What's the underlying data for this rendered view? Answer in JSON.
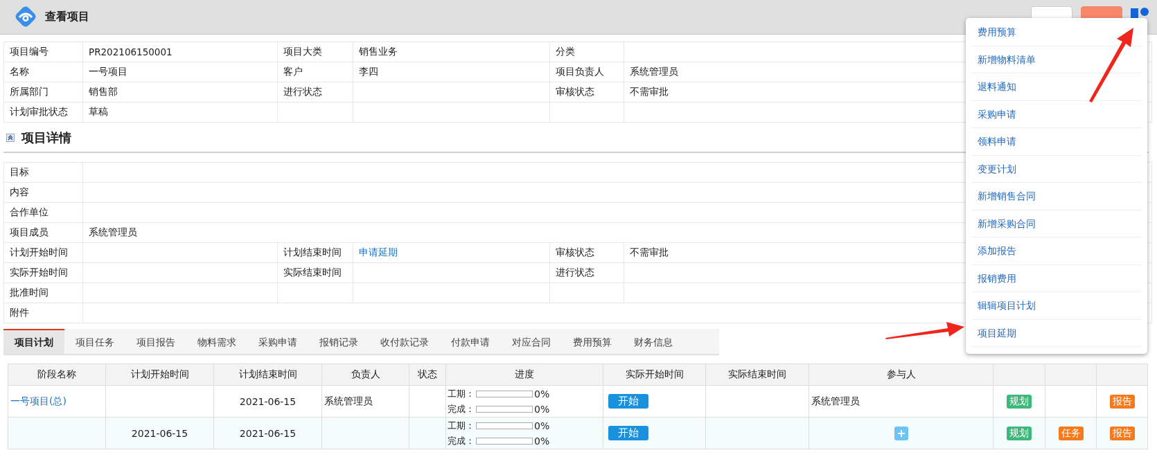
{
  "header": {
    "title": "查看项目",
    "buttons": [
      {
        "kind": "plain"
      },
      {
        "kind": "danger"
      }
    ]
  },
  "info_table": {
    "rows": [
      {
        "cells": [
          {
            "label": "项目编号",
            "value": "PR202106150001"
          },
          {
            "label": "项目大类",
            "value": "销售业务"
          },
          {
            "label": "分类"
          }
        ]
      },
      {
        "cells": [
          {
            "label": "名称",
            "value": "一号项目"
          },
          {
            "label": "客户",
            "value": "李四"
          },
          {
            "label": "项目负责人",
            "value": "系统管理员"
          }
        ]
      },
      {
        "cells": [
          {
            "label": "所属部门",
            "value": "销售部"
          },
          {
            "label": "进行状态"
          },
          {
            "label": "审核状态",
            "value": "不需审批"
          }
        ]
      },
      {
        "cells": [
          {
            "label": "计划审批状态",
            "value": "草稿"
          },
          {},
          {}
        ]
      }
    ]
  },
  "details": {
    "title": "项目详情",
    "expanded": true,
    "rows": [
      {
        "cells": [
          {
            "label": "目标"
          }
        ]
      },
      {
        "cells": [
          {
            "label": "内容"
          }
        ]
      },
      {
        "cells": [
          {
            "label": "合作单位"
          }
        ]
      },
      {
        "cells": [
          {
            "label": "项目成员",
            "value": "系统管理员"
          }
        ]
      },
      {
        "cells": [
          {
            "label": "计划开始时间"
          },
          {
            "label": "计划结束时间",
            "link": "申请延期"
          },
          {
            "label": "审核状态",
            "value": "不需审批"
          }
        ]
      },
      {
        "cells": [
          {
            "label": "实际开始时间"
          },
          {
            "label": "实际结束时间"
          },
          {
            "label": "进行状态"
          }
        ]
      },
      {
        "cells": [
          {
            "label": "批准时间"
          },
          {},
          {}
        ]
      },
      {
        "cells": [
          {
            "label": "附件"
          }
        ]
      }
    ]
  },
  "tabs": [
    {
      "label": "项目计划",
      "selected": true
    },
    {
      "label": "项目任务",
      "selected": false
    },
    {
      "label": "项目报告",
      "selected": false
    },
    {
      "label": "物料需求",
      "selected": false
    },
    {
      "label": "采购申请",
      "selected": false
    },
    {
      "label": "报销记录",
      "selected": false
    },
    {
      "label": "收付款记录",
      "selected": false
    },
    {
      "label": "付款申请",
      "selected": false
    },
    {
      "label": "对应合同",
      "selected": false
    },
    {
      "label": "费用预算",
      "selected": false
    },
    {
      "label": "财务信息",
      "selected": false
    }
  ],
  "plan_table": {
    "columns": [
      "阶段名称",
      "计划开始时间",
      "计划结束时间",
      "负责人",
      "状态",
      "进度",
      "实际开始时间",
      "实际结束时间",
      "参与人"
    ],
    "rows": [
      {
        "stage": "一号项目(总)",
        "plan_end": "2021-06-15",
        "owner": "系统管理员",
        "progress": [
          {
            "label": "工期：",
            "level": 0,
            "reading": "0%"
          },
          {
            "label": "完成：",
            "level": 0,
            "reading": "0%"
          }
        ],
        "start_button": "开始",
        "participants": "系统管理员",
        "actions": [
          {
            "kind": "plan",
            "label": "规划"
          },
          {
            "kind": "none"
          },
          {
            "kind": "report",
            "label": "报告"
          }
        ]
      },
      {
        "plan_start": "2021-06-15",
        "plan_end": "2021-06-15",
        "progress": [
          {
            "label": "工期：",
            "level": 0,
            "reading": "0%"
          },
          {
            "label": "完成：",
            "level": 0,
            "reading": "0%"
          }
        ],
        "start_button": "开始",
        "actions": [
          {
            "kind": "plan",
            "label": "规划"
          },
          {
            "kind": "task",
            "label": "任务"
          },
          {
            "kind": "report",
            "label": "报告"
          }
        ]
      }
    ]
  },
  "menu": {
    "items": [
      "费用预算",
      "新增物料清单",
      "退料通知",
      "采购申请",
      "领料申请",
      "变更计划",
      "新增销售合同",
      "新增采购合同",
      "添加报告",
      "报销费用",
      "辑辑项目计划",
      "项目延期"
    ]
  }
}
